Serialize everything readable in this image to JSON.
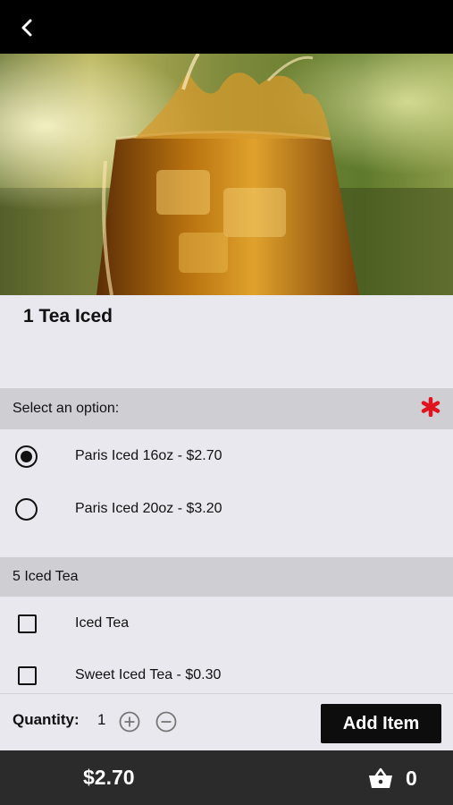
{
  "header": {
    "back_icon": "chevron-left-icon"
  },
  "item": {
    "title": "1 Tea Iced",
    "image": "iced-tea-glass-splash"
  },
  "option_group": {
    "title": "Select an option:",
    "required": true,
    "required_color": "#e0141e",
    "options": [
      {
        "label": "Paris Iced 16oz - $2.70",
        "selected": true
      },
      {
        "label": "Paris Iced 20oz - $3.20",
        "selected": false
      }
    ]
  },
  "addon_group": {
    "title": "5 Iced Tea",
    "options": [
      {
        "label": "Iced Tea",
        "checked": false
      },
      {
        "label": "Sweet Iced Tea - $0.30",
        "checked": false
      }
    ]
  },
  "quantity": {
    "label": "Quantity:",
    "value": "1",
    "plus_icon": "plus-circle-icon",
    "minus_icon": "minus-circle-icon"
  },
  "add_button": {
    "label": "Add Item"
  },
  "footer": {
    "total": "$2.70",
    "cart_icon": "basket-icon",
    "cart_count": "0"
  }
}
